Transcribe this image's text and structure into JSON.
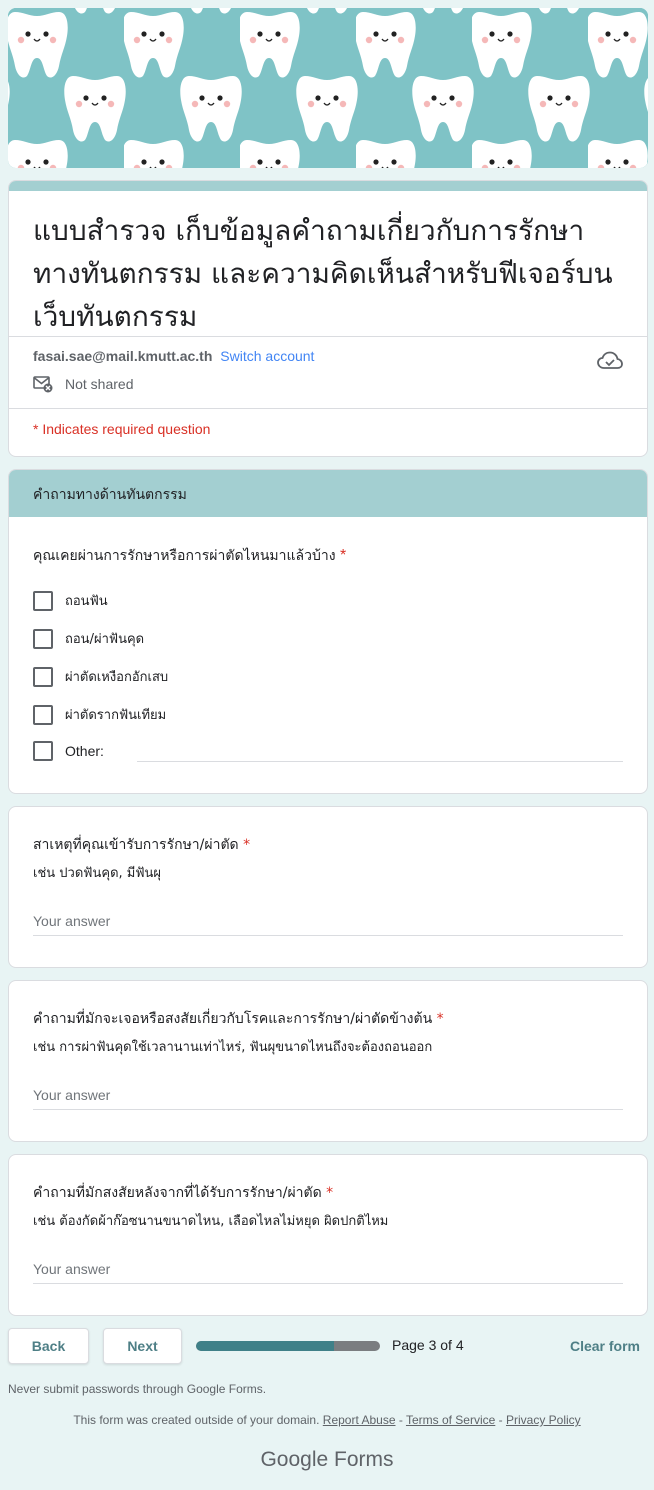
{
  "form": {
    "title": "แบบสำรวจ เก็บข้อมูลคำถามเกี่ยวกับการรักษาทางทันตกรรม  และความคิดเห็นสำหรับฟีเจอร์บนเว็บทันตกรรม",
    "account_email": "fasai.sae@mail.kmutt.ac.th",
    "switch_account": "Switch account",
    "not_shared": "Not shared",
    "required_note": "* Indicates required question"
  },
  "section": {
    "title": "คำถามทางด้านทันตกรรม",
    "q1": {
      "label": "คุณเคยผ่านการรักษาหรือการผ่าตัดไหนมาแล้วบ้าง",
      "required": "*",
      "options": [
        "ถอนฟัน",
        "ถอน/ผ่าฟันคุด",
        "ผ่าตัดเหงือกอักเสบ",
        "ผ่าตัดรากฟันเทียม",
        "Other:"
      ]
    }
  },
  "questions": [
    {
      "label": "สาเหตุที่คุณเข้ารับการรักษา/ผ่าตัด",
      "required": "*",
      "hint": "เช่น ปวดฟันคุด, มีฟันผุ",
      "placeholder": "Your answer"
    },
    {
      "label": "คำถามที่มักจะเจอหรือสงสัยเกี่ยวกับโรคและการรักษา/ผ่าตัดข้างต้น",
      "required": "*",
      "hint": "เช่น การผ่าฟันคุดใช้เวลานานเท่าไหร่, ฟันผุขนาดไหนถึงจะต้องถอนออก",
      "placeholder": "Your answer"
    },
    {
      "label": "คำถามที่มักสงสัยหลังจากที่ได้รับการรักษา/ผ่าตัด",
      "required": "*",
      "hint": "เช่น ต้องกัดผ้าก๊อซนานขนาดไหน, เลือดไหลไม่หยุด ผิดปกติไหม",
      "placeholder": "Your answer"
    }
  ],
  "nav": {
    "back": "Back",
    "next": "Next",
    "progress": 0.75,
    "page_indicator": "Page 3 of 4",
    "clear": "Clear form"
  },
  "footer": {
    "never_submit": "Never submit passwords through Google Forms.",
    "created_outside": "This form was created outside of your domain.",
    "report_abuse": "Report Abuse",
    "terms": "Terms of Service",
    "privacy": "Privacy Policy",
    "sep": " - ",
    "brand_google": "Google",
    "brand_forms": "Forms"
  },
  "colors": {
    "accent": "#a3cfd1",
    "background": "#e8f4f4",
    "progress_fill": "#3f8088",
    "required": "#d93025",
    "link": "#4285f4"
  }
}
